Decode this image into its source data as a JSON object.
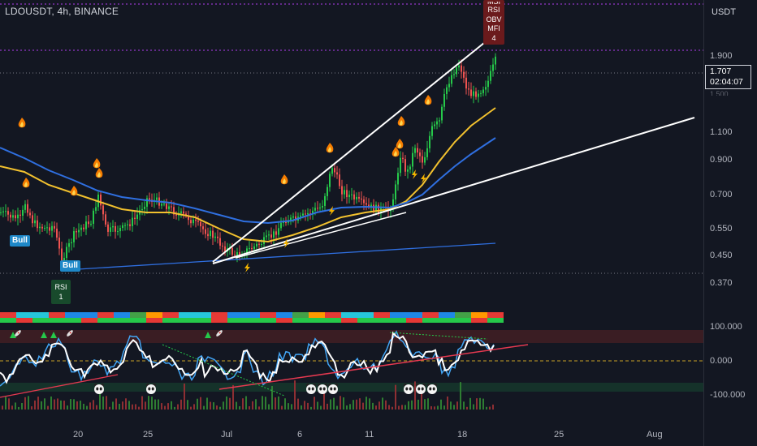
{
  "symbol_title": "LDOUSDT, 4h, BINANCE",
  "price_axis": {
    "currency": "USDT",
    "ticks": [
      "1.900",
      "1.100",
      "0.900",
      "0.700",
      "0.550",
      "0.450",
      "0.370"
    ],
    "hidden_tick": "1.500",
    "last_price": "1.707",
    "countdown": "02:04:07"
  },
  "oscillator_axis": {
    "ticks": [
      "100.000",
      "0.000",
      "-100.000"
    ]
  },
  "time_axis": {
    "ticks": [
      "20",
      "25",
      "Jul",
      "6",
      "11",
      "18",
      "25",
      "Aug"
    ]
  },
  "badges": {
    "bull_1": "Bull",
    "bull_2": "Bull",
    "rsi": [
      "RSI",
      "1"
    ],
    "combo": [
      "MSI",
      "RSI",
      "OBV",
      "MFI",
      "4"
    ]
  },
  "colors": {
    "background": "#131722",
    "candle_up": "#26c94a",
    "candle_down": "#ef5350",
    "ma_yellow": "#f2c12e",
    "ma_blue": "#2f6fe0",
    "trendline": "#ffffff",
    "rsi_line": "#ffffff",
    "rsi_signal": "#42a5f5"
  },
  "icons": [
    "fire-icon",
    "lightning-icon",
    "panda-icon",
    "triangle-up-icon",
    "rocket-icon"
  ]
}
